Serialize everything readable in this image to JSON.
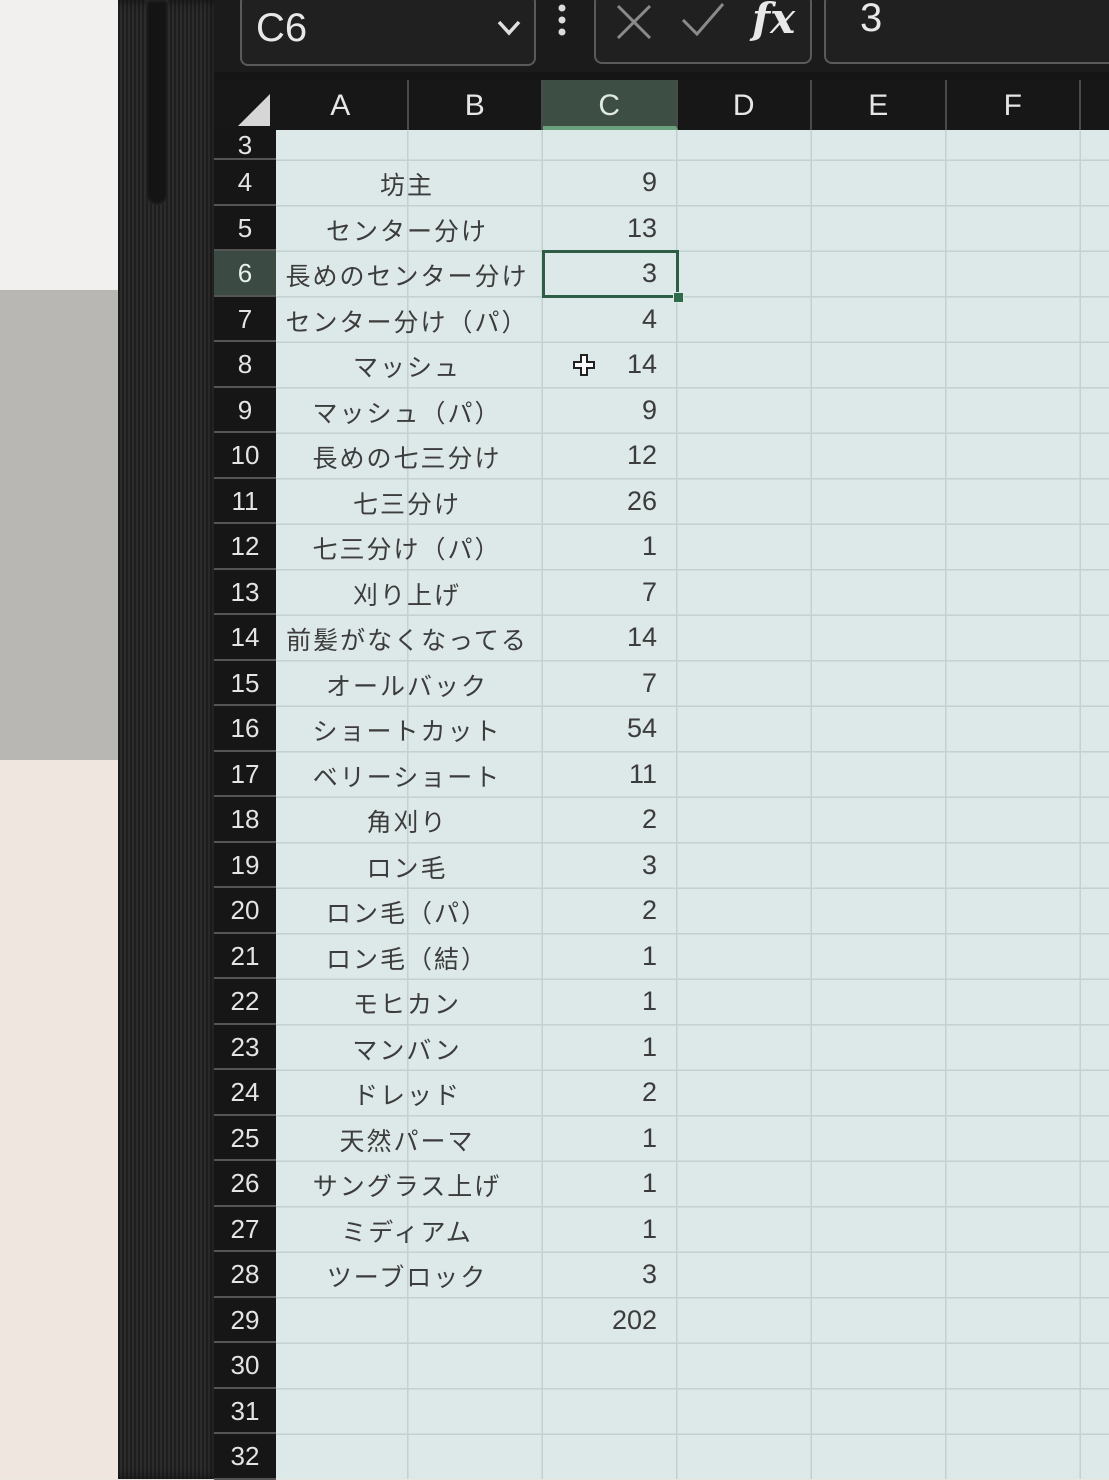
{
  "formula_bar": {
    "name_box": "C6",
    "formula_value": "3"
  },
  "columns": [
    "A",
    "B",
    "C",
    "D",
    "E",
    "F"
  ],
  "selected_column": "C",
  "rows": [
    {
      "num": "3",
      "label": "",
      "value": ""
    },
    {
      "num": "4",
      "label": "坊主",
      "value": "9"
    },
    {
      "num": "5",
      "label": "センター分け",
      "value": "13"
    },
    {
      "num": "6",
      "label": "長めのセンター分け",
      "value": "3"
    },
    {
      "num": "7",
      "label": "センター分け（パ）",
      "value": "4"
    },
    {
      "num": "8",
      "label": "マッシュ",
      "value": "14"
    },
    {
      "num": "9",
      "label": "マッシュ（パ）",
      "value": "9"
    },
    {
      "num": "10",
      "label": "長めの七三分け",
      "value": "12"
    },
    {
      "num": "11",
      "label": "七三分け",
      "value": "26"
    },
    {
      "num": "12",
      "label": "七三分け（パ）",
      "value": "1"
    },
    {
      "num": "13",
      "label": "刈り上げ",
      "value": "7"
    },
    {
      "num": "14",
      "label": "前髪がなくなってる",
      "value": "14"
    },
    {
      "num": "15",
      "label": "オールバック",
      "value": "7"
    },
    {
      "num": "16",
      "label": "ショートカット",
      "value": "54"
    },
    {
      "num": "17",
      "label": "ベリーショート",
      "value": "11"
    },
    {
      "num": "18",
      "label": "角刈り",
      "value": "2"
    },
    {
      "num": "19",
      "label": "ロン毛",
      "value": "3"
    },
    {
      "num": "20",
      "label": "ロン毛（パ）",
      "value": "2"
    },
    {
      "num": "21",
      "label": "ロン毛（結）",
      "value": "1"
    },
    {
      "num": "22",
      "label": "モヒカン",
      "value": "1"
    },
    {
      "num": "23",
      "label": "マンバン",
      "value": "1"
    },
    {
      "num": "24",
      "label": "ドレッド",
      "value": "2"
    },
    {
      "num": "25",
      "label": "天然パーマ",
      "value": "1"
    },
    {
      "num": "26",
      "label": "サングラス上げ",
      "value": "1"
    },
    {
      "num": "27",
      "label": "ミディアム",
      "value": "1"
    },
    {
      "num": "28",
      "label": "ツーブロック",
      "value": "3"
    },
    {
      "num": "29",
      "label": "",
      "value": "202"
    },
    {
      "num": "30",
      "label": "",
      "value": ""
    },
    {
      "num": "31",
      "label": "",
      "value": ""
    },
    {
      "num": "32",
      "label": "",
      "value": ""
    }
  ],
  "active_cell": {
    "column": "C",
    "row": "6"
  },
  "icons": {
    "dropdown": "chevron-down-icon",
    "more": "vertical-dots-icon",
    "cancel": "cancel-x-icon",
    "enter": "checkmark-icon",
    "function": "fx-icon",
    "pointer": "cell-select-cross-icon",
    "select_all": "select-all-triangle-icon"
  },
  "colors": {
    "grid_background": "#dde8e8",
    "selected_header": "#3d4e45",
    "active_border": "#2f5c44"
  }
}
